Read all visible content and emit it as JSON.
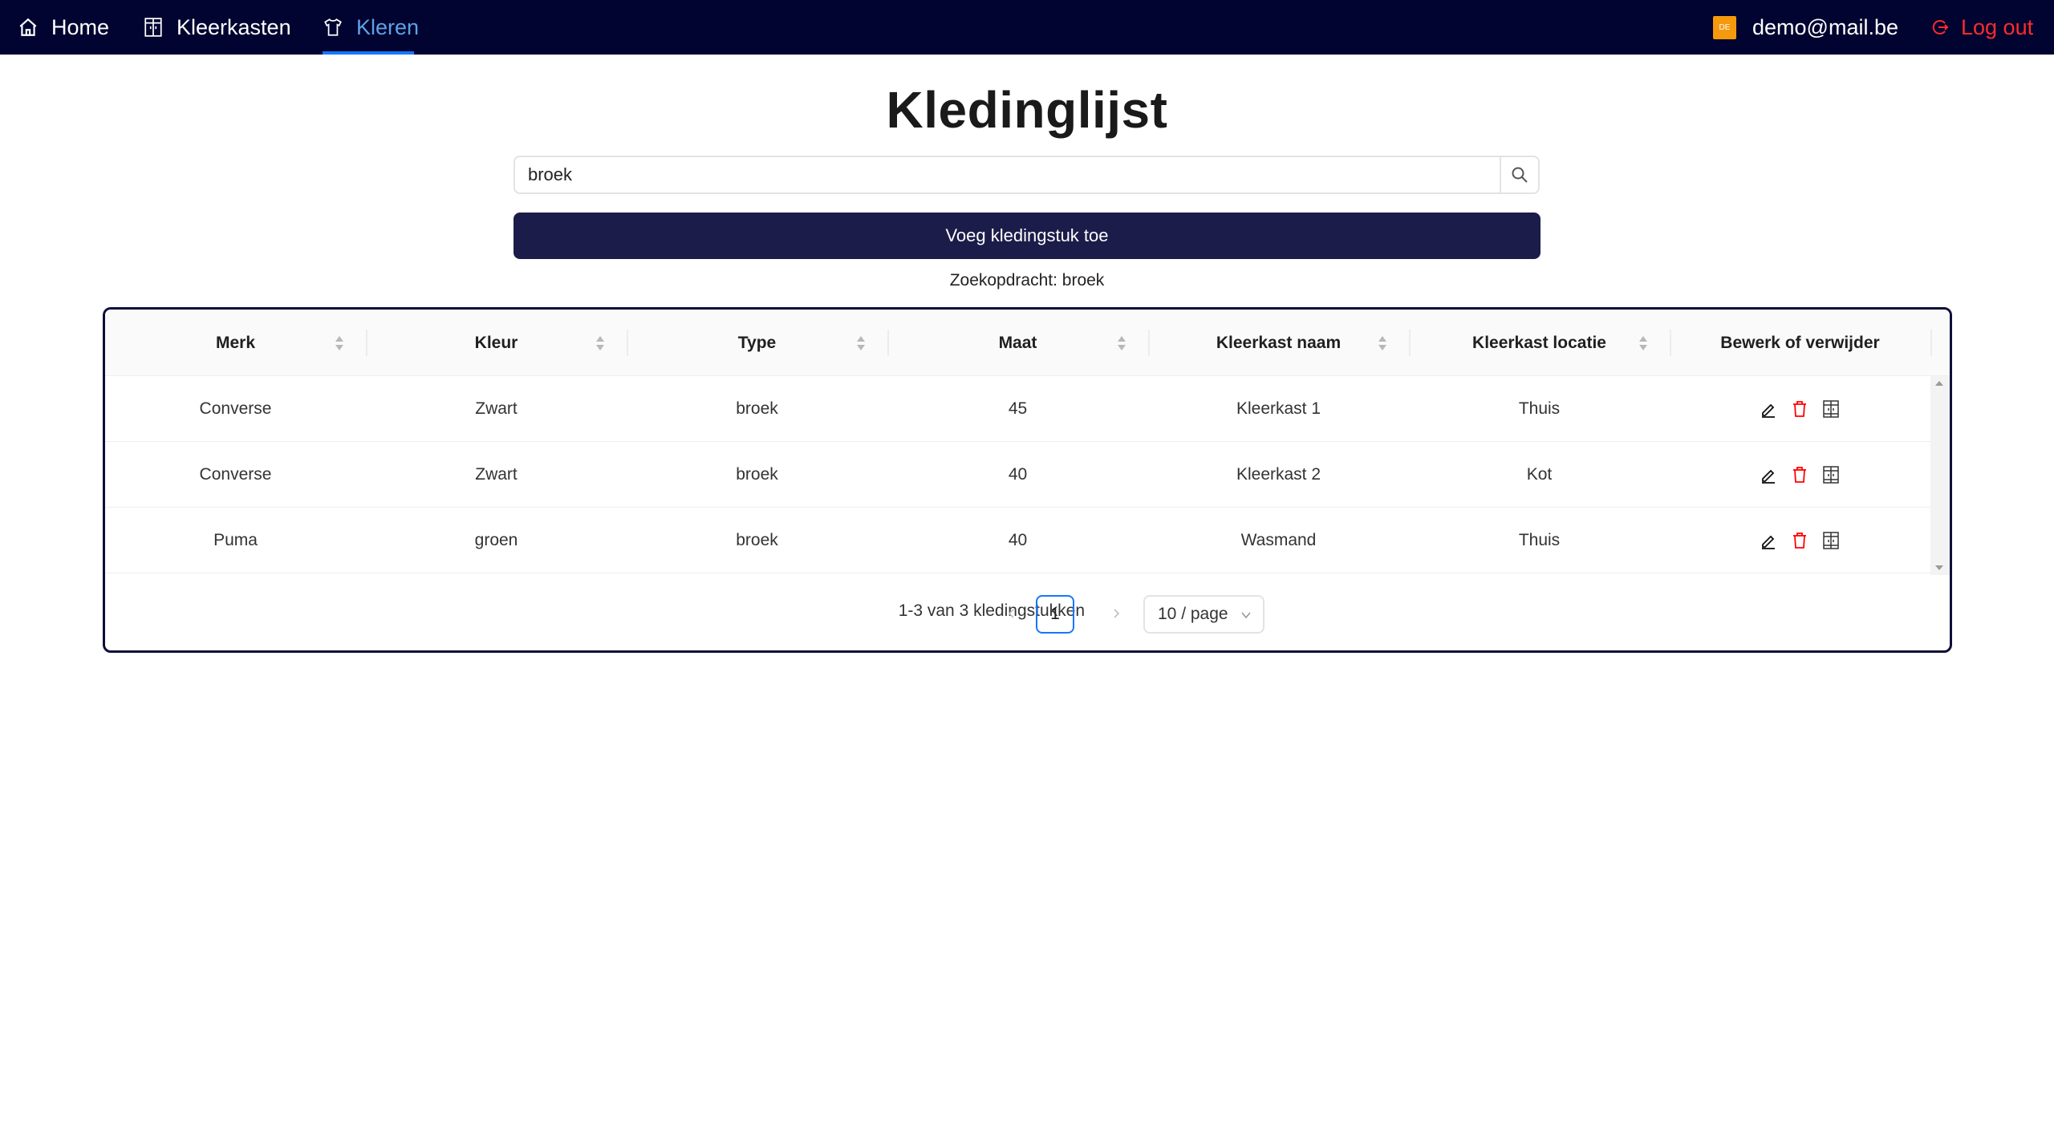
{
  "nav": {
    "home": "Home",
    "kleerkasten": "Kleerkasten",
    "kleren": "Kleren",
    "user_email": "demo@mail.be",
    "avatar_text": "DE",
    "logout": "Log out"
  },
  "page": {
    "title": "Kledinglijst",
    "search_value": "broek",
    "add_button": "Voeg kledingstuk toe",
    "search_query_label": "Zoekopdracht: broek"
  },
  "table": {
    "columns": [
      "Merk",
      "Kleur",
      "Type",
      "Maat",
      "Kleerkast naam",
      "Kleerkast locatie",
      "Bewerk of verwijder"
    ],
    "rows": [
      {
        "merk": "Converse",
        "kleur": "Zwart",
        "type": "broek",
        "maat": "45",
        "kast_naam": "Kleerkast 1",
        "kast_locatie": "Thuis"
      },
      {
        "merk": "Converse",
        "kleur": "Zwart",
        "type": "broek",
        "maat": "40",
        "kast_naam": "Kleerkast 2",
        "kast_locatie": "Kot"
      },
      {
        "merk": "Puma",
        "kleur": "groen",
        "type": "broek",
        "maat": "40",
        "kast_naam": "Wasmand",
        "kast_locatie": "Thuis"
      }
    ]
  },
  "pagination": {
    "total_text": "1-3 van 3 kledingstukken",
    "current_page": "1",
    "page_size": "10 / page"
  },
  "colors": {
    "navbar": "#010430",
    "active_nav": "#5ea1e6",
    "logout": "#ff2b2b",
    "primary_button": "#1c1c4a",
    "delete_icon": "#ff0000",
    "avatar": "#f59a0c"
  }
}
